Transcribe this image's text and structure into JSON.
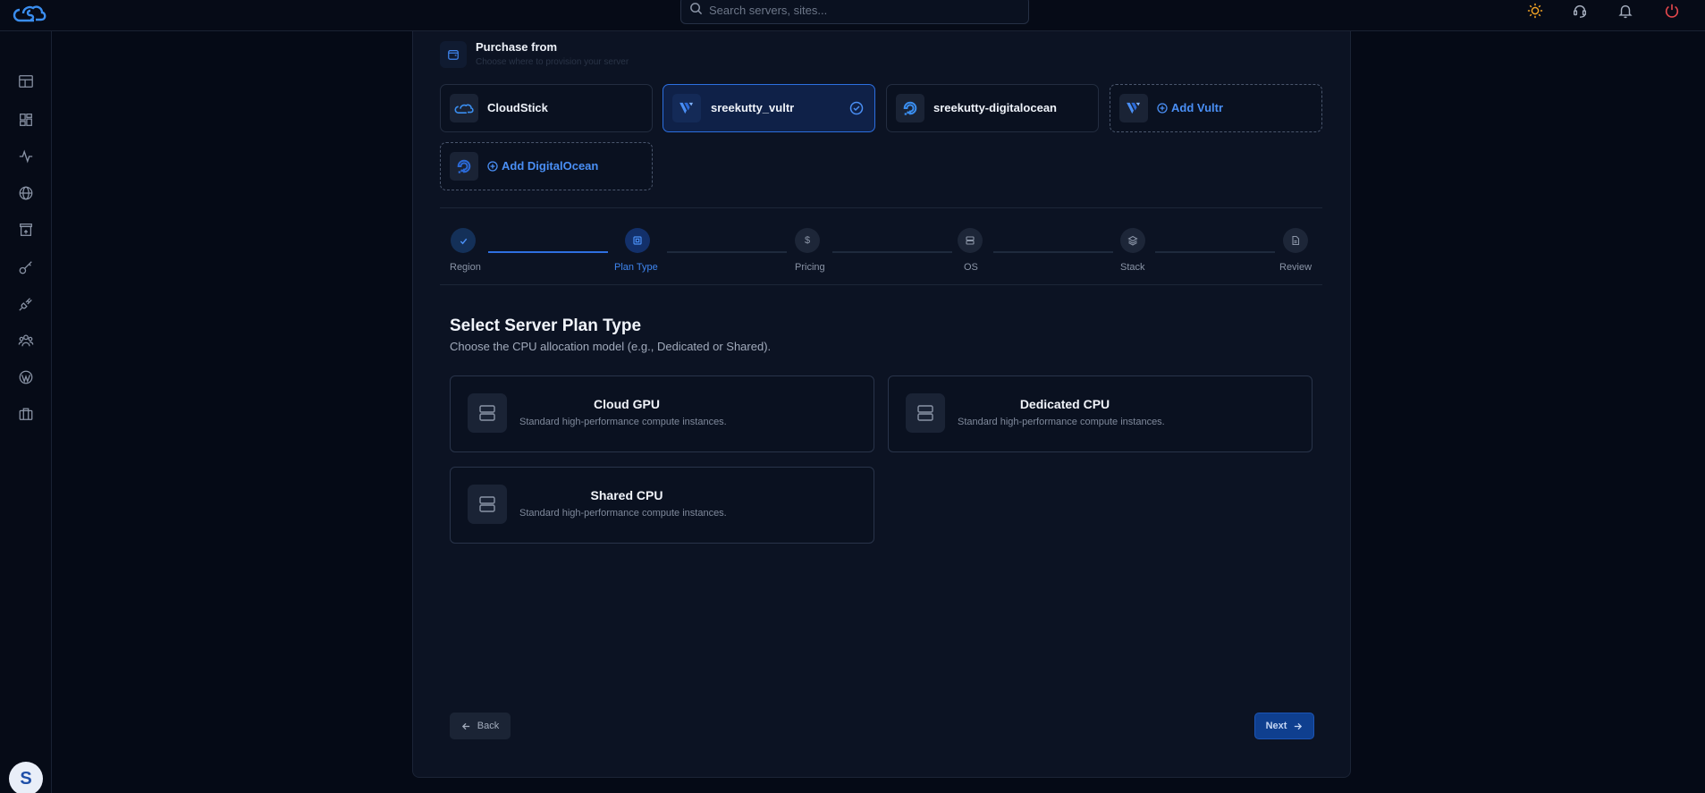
{
  "topbar": {
    "search_placeholder": "Search servers, sites..."
  },
  "purchase": {
    "title": "Purchase from",
    "subtitle": "Choose where to provision your server",
    "providers": [
      {
        "label": "CloudStick",
        "icon": "cloudstick-logo-icon"
      },
      {
        "label": "sreekutty_vultr",
        "icon": "vultr-logo-icon",
        "selected": true
      },
      {
        "label": "sreekutty-digitalocean",
        "icon": "digitalocean-logo-icon"
      },
      {
        "label": "Add Vultr",
        "icon": "vultr-logo-icon",
        "add": true
      },
      {
        "label": "Add DigitalOcean",
        "icon": "digitalocean-logo-icon",
        "add": true
      }
    ]
  },
  "stepper": {
    "steps": [
      {
        "label": "Region",
        "state": "done",
        "icon": "check-icon"
      },
      {
        "label": "Plan Type",
        "state": "active",
        "icon": "cpu-icon"
      },
      {
        "label": "Pricing",
        "state": "pending",
        "icon": "dollar-icon"
      },
      {
        "label": "OS",
        "state": "pending",
        "icon": "server-icon"
      },
      {
        "label": "Stack",
        "state": "pending",
        "icon": "layers-icon"
      },
      {
        "label": "Review",
        "state": "pending",
        "icon": "file-icon"
      }
    ]
  },
  "section": {
    "title": "Select Server Plan Type",
    "subtitle": "Choose the CPU allocation model (e.g., Dedicated or Shared)."
  },
  "plans": [
    {
      "name": "Cloud GPU",
      "desc": "Standard high-performance compute instances."
    },
    {
      "name": "Dedicated CPU",
      "desc": "Standard high-performance compute instances."
    },
    {
      "name": "Shared CPU",
      "desc": "Standard high-performance compute instances."
    }
  ],
  "actions": {
    "back_label": "Back",
    "next_label": "Next"
  },
  "user": {
    "avatar_initial": "S"
  },
  "colors": {
    "accent": "#2f6fe0",
    "background": "#050a16",
    "card": "#0c1323"
  }
}
